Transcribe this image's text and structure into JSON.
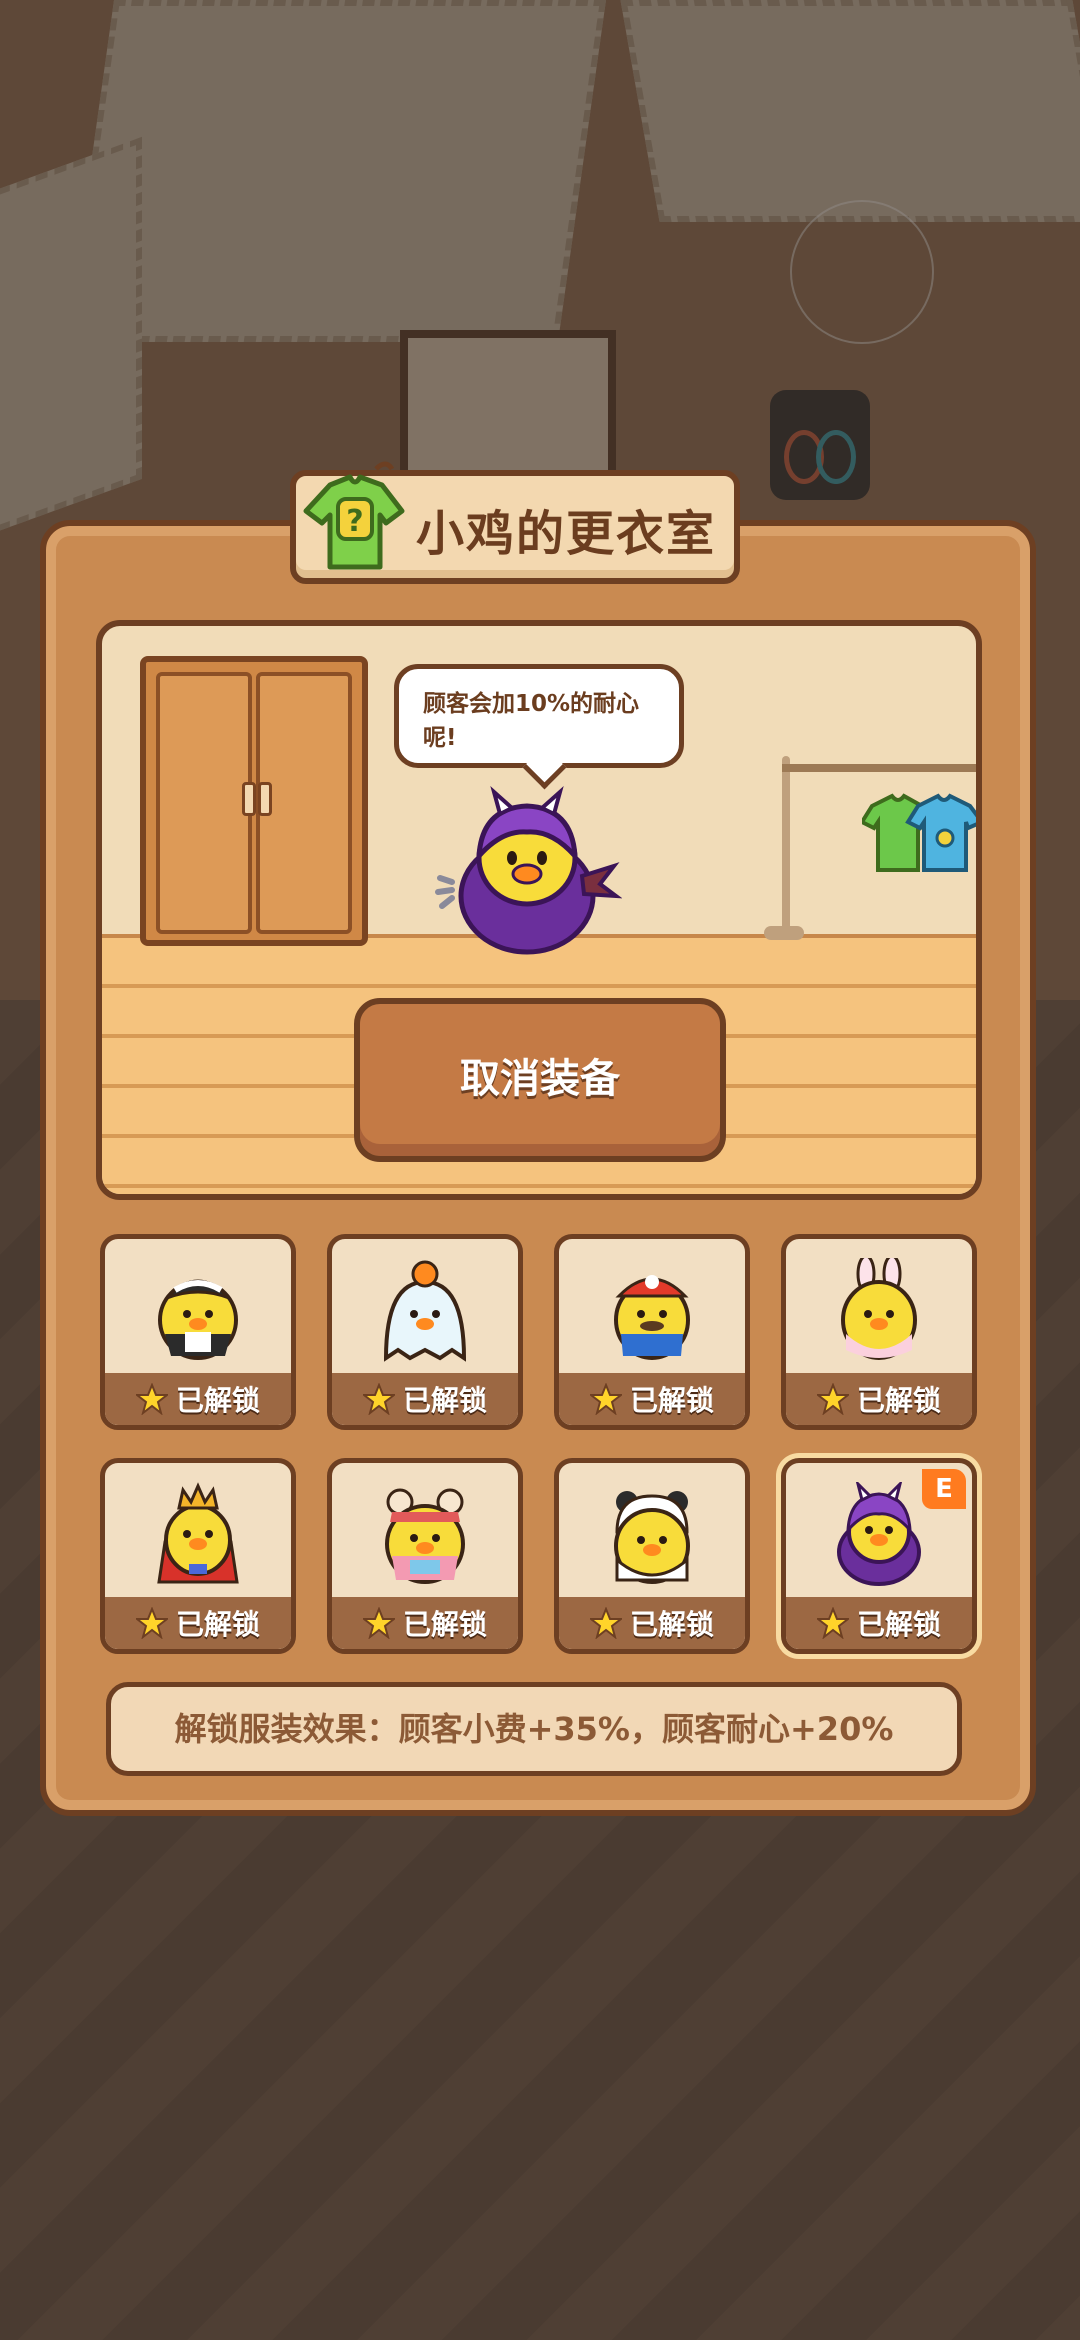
{
  "header": {
    "title": "小鸡的更衣室"
  },
  "scene": {
    "speech": "顾客会加10%的耐心呢!",
    "cancel_button_label": "取消装备"
  },
  "outfits": [
    {
      "name": "maid-outfit",
      "status": "已解锁",
      "selected": false
    },
    {
      "name": "ghost-outfit",
      "status": "已解锁",
      "selected": false
    },
    {
      "name": "plumber-outfit",
      "status": "已解锁",
      "selected": false
    },
    {
      "name": "bunny-outfit",
      "status": "已解锁",
      "selected": false
    },
    {
      "name": "king-outfit",
      "status": "已解锁",
      "selected": false
    },
    {
      "name": "bear-outfit",
      "status": "已解锁",
      "selected": false
    },
    {
      "name": "panda-outfit",
      "status": "已解锁",
      "selected": false
    },
    {
      "name": "devil-outfit",
      "status": "已解锁",
      "selected": true,
      "badge": "E"
    }
  ],
  "effect_text": "解锁服装效果：顾客小费+35%，顾客耐心+20%",
  "colors": {
    "panel": "#c98a51",
    "outline": "#6d3f22",
    "accent_badge": "#ff7b1f",
    "label_bar": "#9c6843"
  }
}
